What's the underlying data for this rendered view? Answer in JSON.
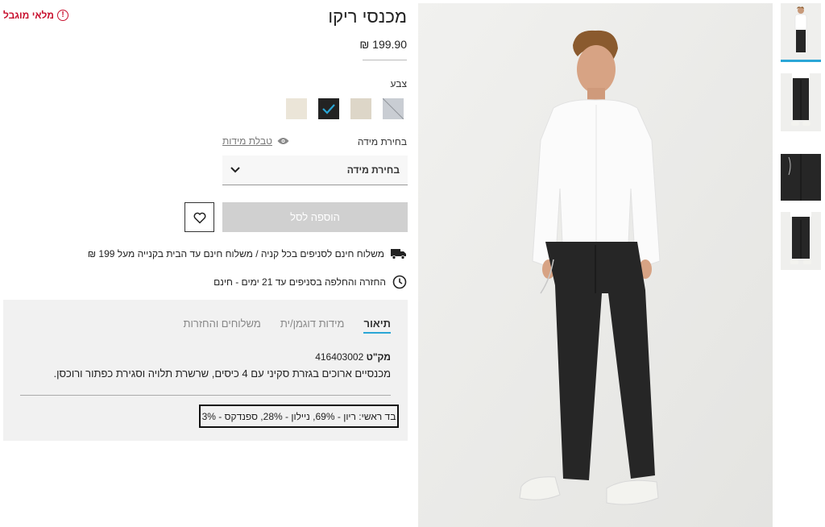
{
  "product": {
    "title": "מכנסי ריקו",
    "soldout_label": "מלאי מוגבל",
    "price": "199.90 ₪",
    "color_label": "צבע",
    "colors": [
      {
        "name": "light-grey",
        "hex": "#c9cdd3"
      },
      {
        "name": "beige",
        "hex": "#ddd6c8"
      },
      {
        "name": "black",
        "hex": "#232323",
        "selected": true
      },
      {
        "name": "cream",
        "hex": "#ebe5d8"
      }
    ],
    "size_label": "בחירת מידה",
    "size_guide_label": "טבלת מידות",
    "size_select_value": "בחירת מידה",
    "add_to_cart_label": "הוספה לסל"
  },
  "shipping": {
    "line1": "משלוח חינם לסניפים בכל קניה / משלוח חינם עד הבית בקנייה מעל 199 ₪",
    "line2": "החזרה והחלפה בסניפים עד 21 ימים - חינם"
  },
  "tabs": {
    "items": [
      {
        "label": "תיאור",
        "active": true
      },
      {
        "label": "מידות דוגמן/ית",
        "active": false
      },
      {
        "label": "משלוחים והחזרות",
        "active": false
      }
    ],
    "sku_key": "מק\"ט",
    "sku_value": "416403002",
    "description": "מכנסיים ארוכים בגזרת סקיני עם 4 כיסים, שרשרת תלויה וסגירת כפתור ורוכסן.",
    "fabric": "בד ראשי: ריון - 69%, ניילון - 28%, ספנדקס - 3%"
  },
  "icons": {
    "soldout": "exclamation-circle-icon",
    "size_guide": "eye-icon",
    "select": "chevron-down-icon",
    "wishlist": "heart-icon",
    "shipping": "truck-icon",
    "returns": "clock-icon",
    "color_selected": "check-icon"
  },
  "colors_ui": {
    "accent": "#2aa6d6",
    "soldout": "#c8102e",
    "disabled_button": "#d0d0d0"
  }
}
